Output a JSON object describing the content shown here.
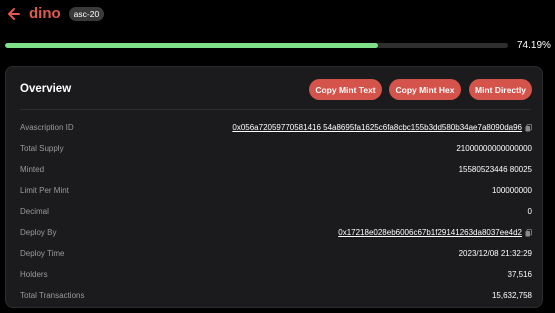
{
  "header": {
    "title": "dino",
    "tag": "asc-20"
  },
  "progress": {
    "fraction": 0.7419,
    "label": "74.19%"
  },
  "overview": {
    "title": "Overview",
    "buttons": {
      "copy_mint_text": "Copy Mint Text",
      "copy_mint_hex": "Copy Mint Hex",
      "mint_directly": "Mint Directly"
    },
    "rows": [
      {
        "label": "Avascription ID",
        "value": "0x056a72059770581416 54a8695fa1625c6fa8cbc155b3dd580b34ae7a8090da96"
      },
      {
        "label": "Total Supply",
        "value": "21000000000000000"
      },
      {
        "label": "Minted",
        "value": "15580523446 80025"
      },
      {
        "label": "Limit Per Mint",
        "value": "100000000"
      },
      {
        "label": "Decimal",
        "value": "0"
      },
      {
        "label": "Deploy By",
        "value": "0x17218e028eb6006c67b1f29141263da8037ee4d2"
      },
      {
        "label": "Deploy Time",
        "value": "2023/12/08 21:32:29"
      },
      {
        "label": "Holders",
        "value": "37,516"
      },
      {
        "label": "Total Transactions",
        "value": "15,632,758"
      }
    ]
  },
  "colors": {
    "accent": "#e05a4f",
    "button": "#d4534a",
    "progress": "#7fe08a",
    "card": "#1b1b1d"
  },
  "icons": {
    "back": "arrow-left-icon",
    "copy": "copy-icon"
  }
}
